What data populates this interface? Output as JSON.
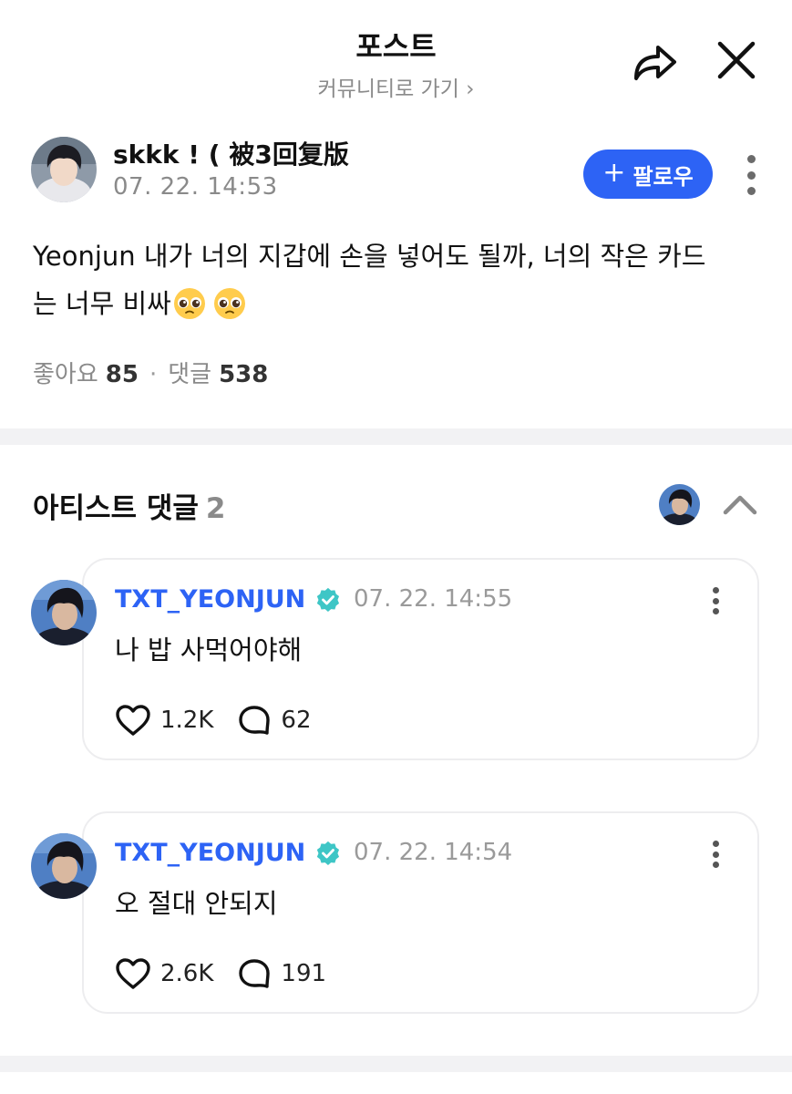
{
  "header": {
    "title": "포스트",
    "community_link": "커뮤니티로 가기 ›"
  },
  "post": {
    "author": "skkk ! ( 被3回复版",
    "time": "07. 22. 14:53",
    "follow_label": "팔로우",
    "body_line1": "Yeonjun 내가 너의 지갑에 손을 넣어도 될까, 너의 작은 카드",
    "body_line2": "는 너무 비싸",
    "emoji": "pleading-face-emoji",
    "likes_label": "좋아요",
    "likes_count": "85",
    "separator": "·",
    "comments_label": "댓글",
    "comments_count": "538"
  },
  "artist_comments": {
    "title": "아티스트 댓글",
    "count": "2",
    "items": [
      {
        "name": "TXT_YEONJUN",
        "time": "07. 22. 14:55",
        "text": "나 밥 사먹어야해",
        "likes": "1.2K",
        "replies": "62"
      },
      {
        "name": "TXT_YEONJUN",
        "time": "07. 22. 14:54",
        "text": "오 절대 안되지",
        "likes": "2.6K",
        "replies": "191"
      }
    ]
  },
  "colors": {
    "accent": "#2d63f5",
    "verified": "#3ec6c6",
    "muted": "#8a8a8a",
    "divider": "#f2f2f4"
  },
  "icons": [
    "share-icon",
    "close-icon",
    "more-vertical-icon",
    "chevron-up-icon",
    "verified-badge-icon",
    "heart-icon",
    "comment-bubble-icon"
  ]
}
